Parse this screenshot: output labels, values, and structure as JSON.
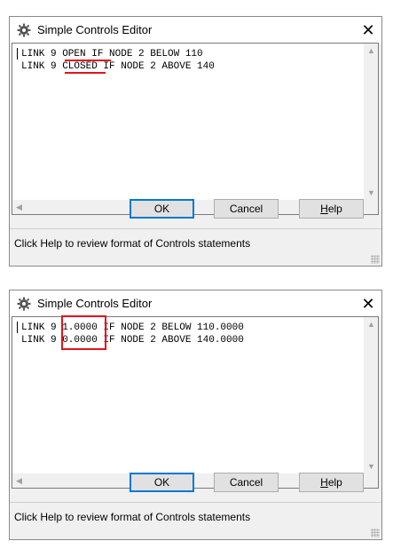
{
  "colors": {
    "highlight": "#e0141e",
    "focus_border": "#0078d7"
  },
  "dialogs": [
    {
      "title": "Simple Controls Editor",
      "close_glyph": "✕",
      "lines": [
        "LINK 9 OPEN IF NODE 2 BELOW 110",
        "LINK 9 CLOSED IF NODE 2 ABOVE 140"
      ],
      "ok_label": "OK",
      "cancel_label": "Cancel",
      "help_label_mnemonic": "H",
      "help_label_rest": "elp",
      "status": "Click Help to review format of Controls statements",
      "highlight_style": "underline",
      "highlighted_tokens": [
        "OPEN IF",
        "CLOSED"
      ]
    },
    {
      "title": "Simple Controls Editor",
      "close_glyph": "✕",
      "lines": [
        "LINK 9 1.0000 IF NODE 2 BELOW 110.0000",
        "LINK 9 0.0000 IF NODE 2 ABOVE 140.0000"
      ],
      "ok_label": "OK",
      "cancel_label": "Cancel",
      "help_label_mnemonic": "H",
      "help_label_rest": "elp",
      "status": "Click Help to review format of Controls statements",
      "highlight_style": "box",
      "highlighted_tokens": [
        "1.0000",
        "0.0000"
      ]
    }
  ]
}
